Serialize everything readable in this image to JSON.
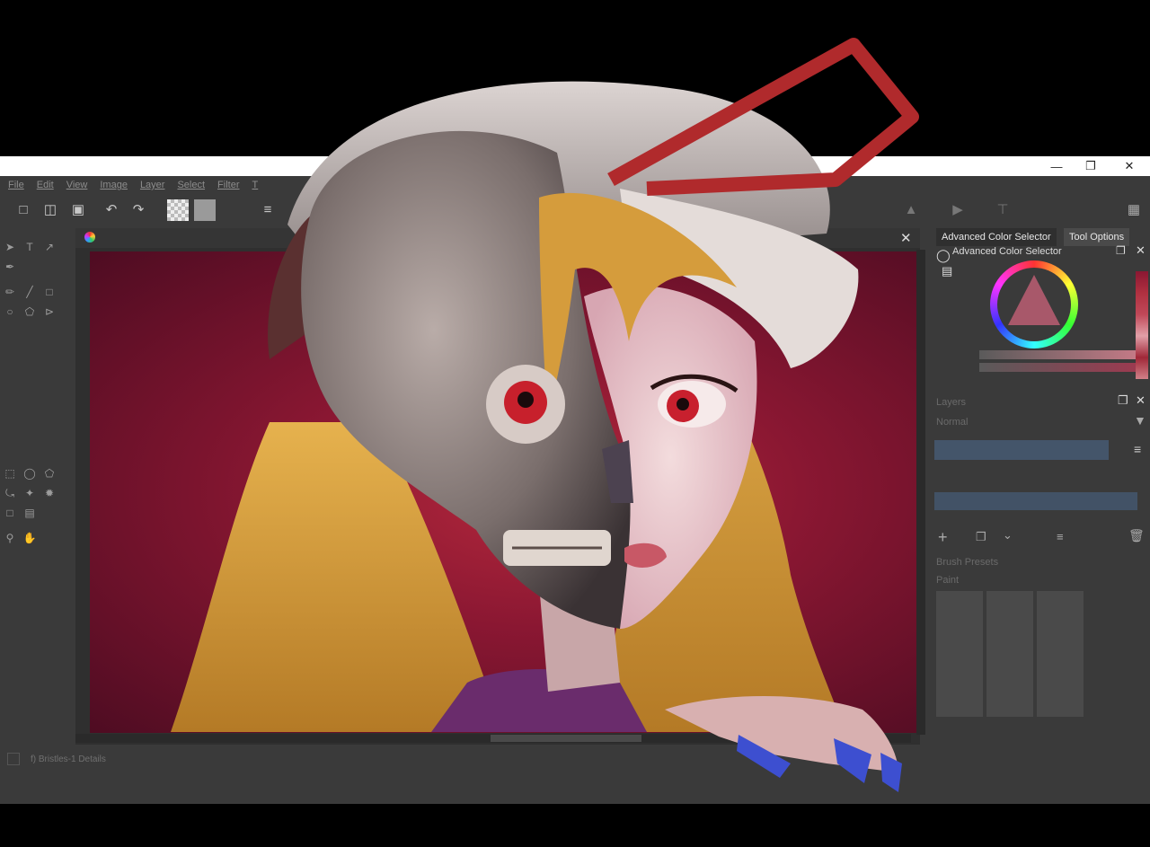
{
  "window": {
    "controls": [
      "minimize-icon",
      "restore-icon",
      "close-icon"
    ]
  },
  "menu": [
    "File",
    "Edit",
    "View",
    "Image",
    "Layer",
    "Select",
    "Filter",
    "T"
  ],
  "dockers": {
    "tabs": [
      "Advanced Color Selector",
      "Tool Options"
    ],
    "color_selector_title": "Advanced Color Selector",
    "layers_title": "Layers",
    "layers_blend": "Normal",
    "brush_title": "Brush Presets",
    "brush_tag": "Paint"
  },
  "status": {
    "brush": "f) Bristles-1 Details"
  },
  "colors": {
    "background": "#000000",
    "app_bg": "#3a3a3a",
    "canvas_red": "#8a1732",
    "hair": "#d7a33e",
    "ribbon": "#b02a2c",
    "nails": "#3d4fd0"
  }
}
